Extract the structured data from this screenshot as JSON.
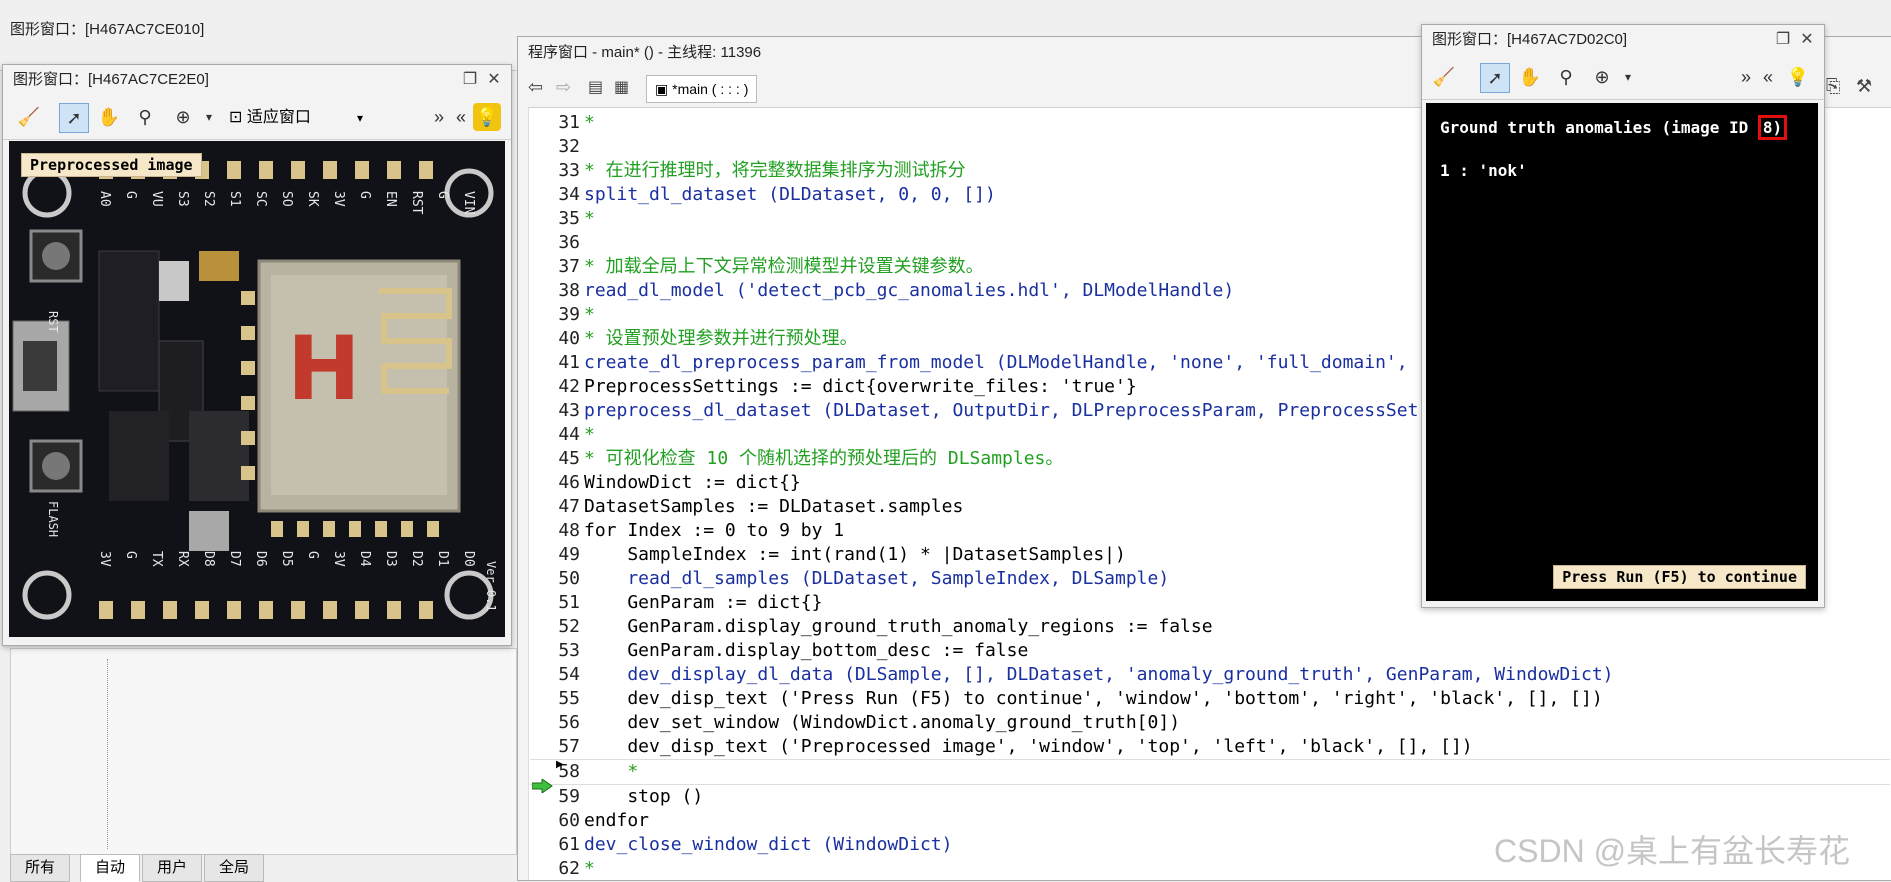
{
  "background_window": {
    "title": "图形窗口：[H467AC7CE010]",
    "fit_label": "适应窗口"
  },
  "left_window": {
    "title": "图形窗口：[H467AC7CE2E0]",
    "fit_label": "适应窗口",
    "overlay_text": "Preprocessed image",
    "board_labels_top": [
      "A0",
      "G",
      "VU",
      "S3",
      "S2",
      "S1",
      "SC",
      "SO",
      "SK",
      "3V",
      "G",
      "EN",
      "RST",
      "G",
      "VIN"
    ],
    "board_labels_bottom": [
      "3V",
      "G",
      "TX",
      "RX",
      "D8",
      "D7",
      "D6",
      "D5",
      "G",
      "3V",
      "D4",
      "D3",
      "D2",
      "D1",
      "D0"
    ],
    "board_labels_side": [
      "RST",
      "FLASH",
      "Ver 0.1"
    ],
    "board_logo": "H"
  },
  "program_window": {
    "title": "程序窗口 - main* () - 主线程: 11396",
    "procedure_label": "*main ( : : : )",
    "lines": [
      {
        "num": "31",
        "text": "*",
        "cls": "c-comment",
        "indent": 0
      },
      {
        "num": "32",
        "text": "",
        "cls": "c-kw",
        "indent": 0
      },
      {
        "num": "33",
        "text": "* 在进行推理时，将完整数据集排序为测试拆分",
        "cls": "c-comment",
        "indent": 0
      },
      {
        "num": "34",
        "text": "split_dl_dataset (DLDataset, 0, 0, [])",
        "cls": "c-op",
        "indent": 0
      },
      {
        "num": "35",
        "text": "*",
        "cls": "c-comment",
        "indent": 0
      },
      {
        "num": "36",
        "text": "",
        "cls": "c-kw",
        "indent": 0
      },
      {
        "num": "37",
        "text": "* 加载全局上下文异常检测模型并设置关键参数。",
        "cls": "c-comment",
        "indent": 0
      },
      {
        "num": "38",
        "text": "read_dl_model ('detect_pcb_gc_anomalies.hdl', DLModelHandle)",
        "cls": "c-op",
        "indent": 0
      },
      {
        "num": "39",
        "text": "*",
        "cls": "c-comment",
        "indent": 0
      },
      {
        "num": "40",
        "text": "* 设置预处理参数并进行预处理。",
        "cls": "c-comment",
        "indent": 0
      },
      {
        "num": "41",
        "text": "create_dl_preprocess_param_from_model (DLModelHandle, 'none', 'full_domain', ",
        "cls": "c-op",
        "indent": 0
      },
      {
        "num": "42",
        "text": "PreprocessSettings := dict{overwrite_files: 'true'}",
        "cls": "c-kw",
        "indent": 0
      },
      {
        "num": "43",
        "text": "preprocess_dl_dataset (DLDataset, OutputDir, DLPreprocessParam, PreprocessSet",
        "cls": "c-op",
        "indent": 0
      },
      {
        "num": "44",
        "text": "*",
        "cls": "c-comment",
        "indent": 0
      },
      {
        "num": "45",
        "text": "* 可视化检查 10 个随机选择的预处理后的 DLSamples。",
        "cls": "c-comment",
        "indent": 0
      },
      {
        "num": "46",
        "text": "WindowDict := dict{}",
        "cls": "c-kw",
        "indent": 0
      },
      {
        "num": "47",
        "text": "DatasetSamples := DLDataset.samples",
        "cls": "c-kw",
        "indent": 0
      },
      {
        "num": "48",
        "text": "for Index := 0 to 9 by 1",
        "cls": "c-kw",
        "indent": 0
      },
      {
        "num": "49",
        "text": "    SampleIndex := int(rand(1) * |DatasetSamples|)",
        "cls": "c-kw",
        "indent": 0
      },
      {
        "num": "50",
        "text": "    read_dl_samples (DLDataset, SampleIndex, DLSample)",
        "cls": "c-op",
        "indent": 0
      },
      {
        "num": "51",
        "text": "    GenParam := dict{}",
        "cls": "c-kw",
        "indent": 0
      },
      {
        "num": "52",
        "text": "    GenParam.display_ground_truth_anomaly_regions := false",
        "cls": "c-kw",
        "indent": 0
      },
      {
        "num": "53",
        "text": "    GenParam.display_bottom_desc := false",
        "cls": "c-kw",
        "indent": 0
      },
      {
        "num": "54",
        "text": "    dev_display_dl_data (DLSample, [], DLDataset, 'anomaly_ground_truth', GenParam, WindowDict)",
        "cls": "c-op",
        "indent": 0
      },
      {
        "num": "55",
        "text": "    dev_disp_text ('Press Run (F5) to continue', 'window', 'bottom', 'right', 'black', [], [])",
        "cls": "c-kw",
        "indent": 0
      },
      {
        "num": "56",
        "text": "    dev_set_window (WindowDict.anomaly_ground_truth[0])",
        "cls": "c-kw",
        "indent": 0
      },
      {
        "num": "57",
        "text": "    dev_disp_text ('Preprocessed image', 'window', 'top', 'left', 'black', [], [])",
        "cls": "c-kw",
        "indent": 0
      },
      {
        "num": "58",
        "text": "    *",
        "cls": "c-comment",
        "indent": 0
      },
      {
        "num": "59",
        "text": "    stop ()",
        "cls": "c-kw",
        "indent": 0
      },
      {
        "num": "60",
        "text": "endfor",
        "cls": "c-kw",
        "indent": 0
      },
      {
        "num": "61",
        "text": "dev_close_window_dict (WindowDict)",
        "cls": "c-op",
        "indent": 0
      },
      {
        "num": "62",
        "text": "*",
        "cls": "c-comment",
        "indent": 0
      }
    ]
  },
  "right_window": {
    "title": "图形窗口：[H467AC7D02C0]",
    "heading_prefix": "Ground truth anomalies (image ID ",
    "heading_id": "8)",
    "class_line": "1 : 'nok'",
    "continue_text": "Press Run (F5) to continue"
  },
  "bottom_tabs": [
    "所有",
    "自动",
    "用户",
    "全局"
  ],
  "watermark": "CSDN @桌上有盆长寿花",
  "colors": {
    "comment": "#22a022",
    "operator": "#1a2fa0",
    "highlight_box": "#e01010",
    "overlay_bg": "#f6e7c9"
  }
}
